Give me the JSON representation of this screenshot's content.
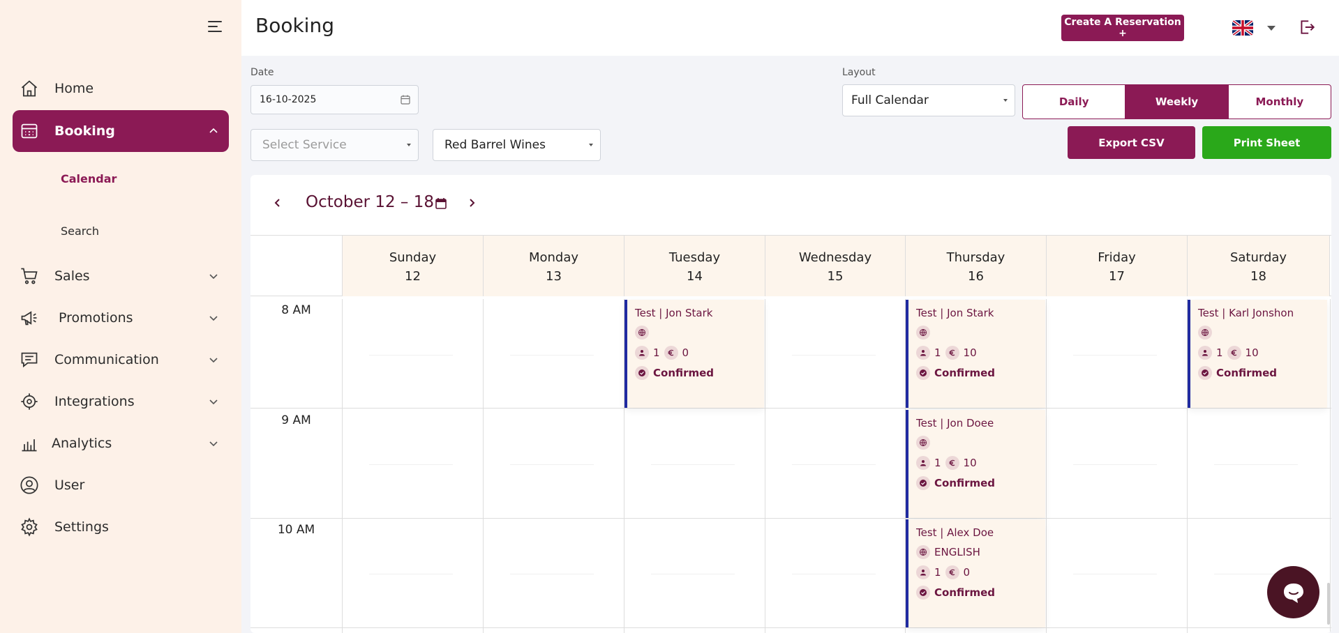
{
  "sidebar": {
    "items": [
      {
        "label": "Home",
        "icon": "home-icon"
      },
      {
        "label": "Booking",
        "icon": "calendar-grid-icon"
      },
      {
        "label": "Sales",
        "icon": "cart-icon"
      },
      {
        "label": "Promotions",
        "icon": "megaphone-icon"
      },
      {
        "label": "Communication",
        "icon": "chat-icon"
      },
      {
        "label": "Integrations",
        "icon": "integrations-icon"
      },
      {
        "label": "Analytics",
        "icon": "bar-chart-icon"
      },
      {
        "label": "User",
        "icon": "user-icon"
      },
      {
        "label": "Settings",
        "icon": "gear-icon"
      }
    ],
    "booking_sub": [
      {
        "label": "Calendar"
      },
      {
        "label": "Search"
      }
    ]
  },
  "header": {
    "title": "Booking",
    "create_label": "Create A Reservation +"
  },
  "filters": {
    "date_label": "Date",
    "date_value": "16-10-2025",
    "layout_label": "Layout",
    "layout_value": "Full Calendar",
    "service_placeholder": "Select Service",
    "winery_value": "Red Barrel Wines",
    "views": [
      {
        "label": "Daily"
      },
      {
        "label": "Weekly"
      },
      {
        "label": "Monthly"
      }
    ],
    "export_label": "Export CSV",
    "print_label": "Print Sheet"
  },
  "calendar": {
    "range": "October 12 – 18",
    "days": [
      {
        "name": "Sunday",
        "num": "12"
      },
      {
        "name": "Monday",
        "num": "13"
      },
      {
        "name": "Tuesday",
        "num": "14"
      },
      {
        "name": "Wednesday",
        "num": "15"
      },
      {
        "name": "Thursday",
        "num": "16"
      },
      {
        "name": "Friday",
        "num": "17"
      },
      {
        "name": "Saturday",
        "num": "18"
      }
    ],
    "hours": [
      "8 AM",
      "9 AM",
      "10 AM"
    ],
    "events": [
      {
        "title": "Test | Jon Stark",
        "language": "",
        "guests": "1",
        "price": "0",
        "status": "Confirmed"
      },
      {
        "title": "Test | Jon Stark",
        "language": "",
        "guests": "1",
        "price": "10",
        "status": "Confirmed"
      },
      {
        "title": "Test | Karl Jonshon",
        "language": "",
        "guests": "1",
        "price": "10",
        "status": "Confirmed"
      },
      {
        "title": "Test | Jon Doee",
        "language": "",
        "guests": "1",
        "price": "10",
        "status": "Confirmed"
      },
      {
        "title": "Test | Alex Doe",
        "language": "ENGLISH",
        "guests": "1",
        "price": "0",
        "status": "Confirmed"
      }
    ]
  },
  "colors": {
    "brand": "#8b1a55",
    "print_green": "#2aa81a",
    "event_border": "#1f2aa0",
    "sidebar_bg": "#fdf1e8"
  }
}
